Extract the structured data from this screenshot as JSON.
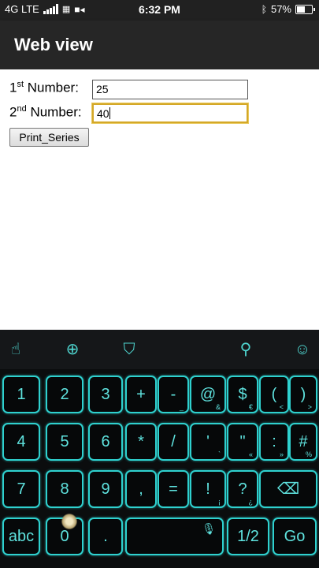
{
  "status_bar": {
    "network": "4G LTE",
    "time": "6:32 PM",
    "battery_percent": "57%",
    "battery_level": 0.57
  },
  "app_bar": {
    "title": "Web view"
  },
  "form": {
    "first_label_num": "1",
    "first_label_sup": "st",
    "first_label_text": " Number:",
    "first_value": "25",
    "second_label_num": "2",
    "second_label_sup": "nd",
    "second_label_text": " Number:",
    "second_value": "40",
    "button_label": "Print_Series"
  },
  "keyboard": {
    "toolbar": [
      "swipe-hand-icon",
      "globe-icon",
      "tshirt-icon",
      "search-icon",
      "emoji-icon"
    ],
    "rows": [
      [
        {
          "label": "1"
        },
        {
          "label": "2"
        },
        {
          "label": "3"
        },
        {
          "label": "+"
        },
        {
          "label": "-",
          "hint": "_"
        },
        {
          "label": "@",
          "hint": "&"
        },
        {
          "label": "$",
          "hint": "€"
        },
        {
          "label": "(",
          "hint": "<"
        },
        {
          "label": ")",
          "hint": ">"
        }
      ],
      [
        {
          "label": "4"
        },
        {
          "label": "5"
        },
        {
          "label": "6"
        },
        {
          "label": "*"
        },
        {
          "label": "/"
        },
        {
          "label": "'",
          "hint": "`"
        },
        {
          "label": "\"",
          "hint": "«"
        },
        {
          "label": ":",
          "hint": "»"
        },
        {
          "label": "#",
          "hint": "%"
        }
      ],
      [
        {
          "label": "7"
        },
        {
          "label": "8"
        },
        {
          "label": "9"
        },
        {
          "label": ","
        },
        {
          "label": "="
        },
        {
          "label": "!",
          "hint": "¡"
        },
        {
          "label": "?",
          "hint": "¿"
        },
        {
          "label": "backspace"
        }
      ],
      [
        {
          "label": "abc"
        },
        {
          "label": "0"
        },
        {
          "label": "."
        },
        {
          "label": "space"
        },
        {
          "label": "1/2"
        },
        {
          "label": "Go"
        }
      ]
    ]
  },
  "colors": {
    "accent": "#2fd1cf",
    "appbar": "#262626",
    "focus": "#d4a828"
  }
}
